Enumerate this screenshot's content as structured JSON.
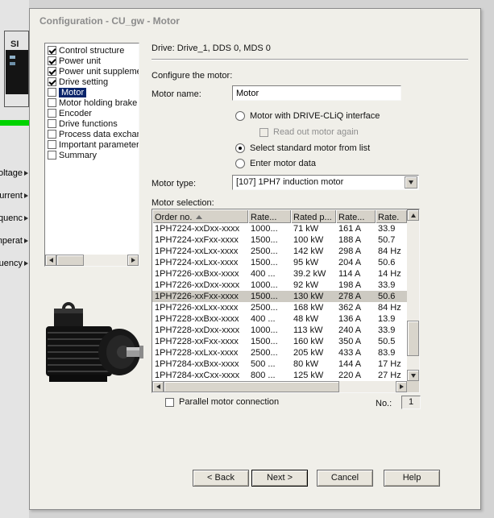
{
  "colors": {
    "selection_blue": "#0a246a",
    "status_green": "#00d300",
    "face_gray": "#d9d5cc"
  },
  "icons": {
    "sort_ascending": "triangle-up",
    "dropdown": "triangle-down",
    "scroll_left": "triangle-left",
    "scroll_right": "triangle-right",
    "scroll_up": "triangle-up",
    "scroll_down": "triangle-down",
    "checked": "checkmark"
  },
  "desktop": {
    "si_label": "SI",
    "left_labels": [
      "voltage",
      "current",
      "frequenc",
      "temperat",
      "quency"
    ]
  },
  "dialog": {
    "title": "Configuration - CU_gw - Motor",
    "steps": [
      {
        "label": "Control structure",
        "checked": true
      },
      {
        "label": "Power unit",
        "checked": true
      },
      {
        "label": "Power unit supplement",
        "checked": true
      },
      {
        "label": "Drive setting",
        "checked": true
      },
      {
        "label": "Motor",
        "checked": false,
        "selected": true
      },
      {
        "label": "Motor holding brake",
        "checked": false
      },
      {
        "label": "Encoder",
        "checked": false
      },
      {
        "label": "Drive functions",
        "checked": false
      },
      {
        "label": "Process data exchange",
        "checked": false
      },
      {
        "label": "Important parameters",
        "checked": false
      },
      {
        "label": "Summary",
        "checked": false
      }
    ],
    "drive_info": "Drive: Drive_1, DDS 0, MDS 0",
    "configure_label": "Configure the motor:",
    "motor_name": {
      "label": "Motor name:",
      "value": "Motor"
    },
    "options": {
      "drive_cliq": "Motor with DRIVE-CLiQ interface",
      "read_out": "Read out motor again",
      "standard_list": "Select standard motor from list",
      "enter_data": "Enter motor data",
      "selected": "standard_list"
    },
    "motor_type": {
      "label": "Motor type:",
      "value": "[107] 1PH7 induction motor"
    },
    "motor_selection_label": "Motor selection:",
    "table": {
      "columns": [
        "Order no.",
        "Rate...",
        "Rated p...",
        "Rate...",
        "Rate."
      ],
      "rows": [
        {
          "order": "1PH7224-xxDxx-xxxx",
          "speed": "1000...",
          "power": "71 kW",
          "current": "161 A",
          "freq": "33.9"
        },
        {
          "order": "1PH7224-xxFxx-xxxx",
          "speed": "1500...",
          "power": "100 kW",
          "current": "188 A",
          "freq": "50.7"
        },
        {
          "order": "1PH7224-xxLxx-xxxx",
          "speed": "2500...",
          "power": "142 kW",
          "current": "298 A",
          "freq": "84 Hz"
        },
        {
          "order": "1PH7224-xxLxx-xxxx",
          "speed": "1500...",
          "power": "95 kW",
          "current": "204 A",
          "freq": "50.6"
        },
        {
          "order": "1PH7226-xxBxx-xxxx",
          "speed": "400 ...",
          "power": "39.2 kW",
          "current": "114 A",
          "freq": "14 Hz"
        },
        {
          "order": "1PH7226-xxDxx-xxxx",
          "speed": "1000...",
          "power": "92 kW",
          "current": "198 A",
          "freq": "33.9"
        },
        {
          "order": "1PH7226-xxFxx-xxxx",
          "speed": "1500...",
          "power": "130 kW",
          "current": "278 A",
          "freq": "50.6",
          "selected": true
        },
        {
          "order": "1PH7226-xxLxx-xxxx",
          "speed": "2500...",
          "power": "168 kW",
          "current": "362 A",
          "freq": "84 Hz"
        },
        {
          "order": "1PH7228-xxBxx-xxxx",
          "speed": "400 ...",
          "power": "48 kW",
          "current": "136 A",
          "freq": "13.9"
        },
        {
          "order": "1PH7228-xxDxx-xxxx",
          "speed": "1000...",
          "power": "113 kW",
          "current": "240 A",
          "freq": "33.9"
        },
        {
          "order": "1PH7228-xxFxx-xxxx",
          "speed": "1500...",
          "power": "160 kW",
          "current": "350 A",
          "freq": "50.5"
        },
        {
          "order": "1PH7228-xxLxx-xxxx",
          "speed": "2500...",
          "power": "205 kW",
          "current": "433 A",
          "freq": "83.9"
        },
        {
          "order": "1PH7284-xxBxx-xxxx",
          "speed": "500 ...",
          "power": "80 kW",
          "current": "144 A",
          "freq": "17 Hz"
        },
        {
          "order": "1PH7284-xxCxx-xxxx",
          "speed": "800 ...",
          "power": "125 kW",
          "current": "220 A",
          "freq": "27 Hz"
        }
      ]
    },
    "parallel": {
      "label": "Parallel motor connection",
      "no_label": "No.:",
      "no_value": "1"
    },
    "buttons": {
      "back": "< Back",
      "next": "Next >",
      "cancel": "Cancel",
      "help": "Help"
    }
  }
}
